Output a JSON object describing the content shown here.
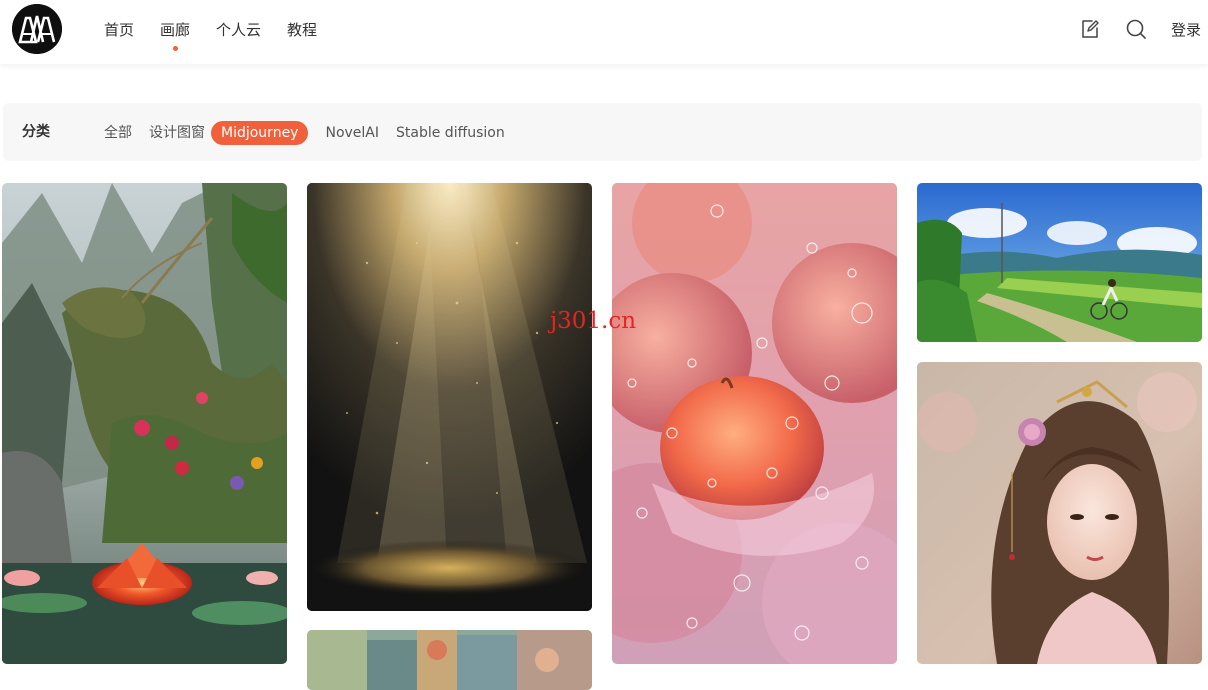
{
  "site": {
    "logo_text": "AAI"
  },
  "nav": {
    "items": [
      {
        "label": "首页"
      },
      {
        "label": "画廊"
      },
      {
        "label": "个人云"
      },
      {
        "label": "教程"
      }
    ],
    "active_index": 1
  },
  "header_actions": {
    "write_icon": "edit-icon",
    "search_icon": "search-icon",
    "login_label": "登录"
  },
  "categories": {
    "label": "分类",
    "items": [
      {
        "label": "全部"
      },
      {
        "label": "设计图窗"
      },
      {
        "label": "Midjourney"
      },
      {
        "label": "NovelAI"
      },
      {
        "label": "Stable diffusion"
      }
    ],
    "active_index": 2
  },
  "gallery": {
    "images": [
      {
        "name": "dragon-lotus-image"
      },
      {
        "name": "light-rays-image"
      },
      {
        "name": "textile-image"
      },
      {
        "name": "peach-bubbles-image"
      },
      {
        "name": "cyclist-landscape-image"
      },
      {
        "name": "chinese-woman-portrait-image"
      }
    ]
  },
  "watermark": "j301.cn",
  "colors": {
    "accent": "#f0603a",
    "watermark": "#e62424"
  }
}
